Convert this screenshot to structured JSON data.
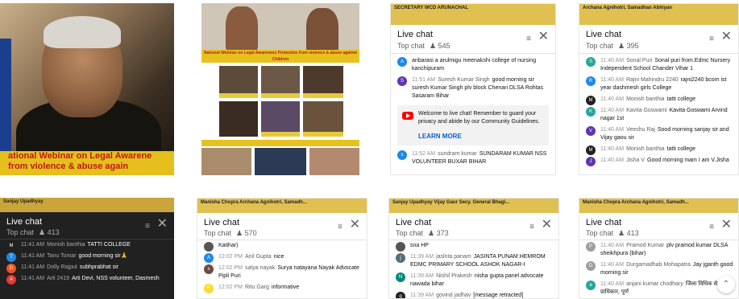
{
  "tiles": {
    "video1": {
      "banner_line1": "ational Webinar on Legal Awarene",
      "banner_line2": "from violence & abuse  again"
    },
    "video2": {
      "strip_text": "National Webinar on Legal Awareness Protection from violence & abuse against Children"
    },
    "chat1": {
      "header_text": "SECRETARY WCD ARUNACHAL",
      "title": "Live chat",
      "mode": "Top chat",
      "viewers": "545",
      "messages": [
        {
          "avatar": "A",
          "color": "#1e88e5",
          "time": "",
          "author": "",
          "text": "anbarasi a arulmigu meenakshi college of nursing kanchipuram"
        },
        {
          "avatar": "S",
          "color": "#5e35b1",
          "time": "11:51 AM",
          "author": "Suresh Kumar Singh",
          "text": "good morning sir suresh Kumar Singh plv block Chenari DLSA Rohtas Sasaram Bihar"
        }
      ],
      "notice": "Welcome to live chat! Remember to guard your privacy and abide by our Community Guidelines.",
      "learn_more": "LEARN MORE",
      "messages2": [
        {
          "avatar": "s",
          "color": "#1e88e5",
          "time": "11:52 AM",
          "author": "sundram kumar",
          "text": "SUNDARAM KUMAR NSS VOLUNTEER BUXAR BIHAR"
        }
      ]
    },
    "chat2": {
      "header_text": "Archana Agnihotri, Samadhan Abhiyan",
      "title": "Live chat",
      "mode": "Top chat",
      "viewers": "395",
      "messages": [
        {
          "avatar": "S",
          "color": "#26a69a",
          "time": "11:40 AM",
          "author": "Sonal Puri",
          "text": "Sonal puri from.Edmc Nursery Independent School Chander Vihar 1"
        },
        {
          "avatar": "R",
          "color": "#1e88e5",
          "time": "11:40 AM",
          "author": "Rajni Mahindru 2240",
          "text": "rajni2240 bcom ist year dashmesh girls College"
        },
        {
          "avatar": "M",
          "color": "#212121",
          "time": "11:40 AM",
          "author": "Monish banthia",
          "text": "tatti college"
        },
        {
          "avatar": "K",
          "color": "#26a69a",
          "time": "11:40 AM",
          "author": "Kavita Goswami",
          "text": "Kavita Goswami Arvind nagar 1st"
        },
        {
          "avatar": "V",
          "color": "#5e35b1",
          "time": "11:40 AM",
          "author": "Veeshu Raj",
          "text": "Sood morning sanjay sir and Vijay gaou sir"
        },
        {
          "avatar": "M",
          "color": "#212121",
          "time": "11:40 AM",
          "author": "Monish banthia",
          "text": "tatti college"
        },
        {
          "avatar": "J",
          "color": "#5e35b1",
          "time": "11:40 AM",
          "author": "Jisha V",
          "text": "Good morning mam I am V.Jisha"
        }
      ]
    },
    "chat3": {
      "header_text": "Sanjay Upadhyay",
      "title": "Live chat",
      "mode": "Top chat",
      "viewers": "413",
      "messages": [
        {
          "avatar": "M",
          "color": "#212121",
          "time": "11:41 AM",
          "author": "Monish banthia",
          "text": "TATTI COLLEGE"
        },
        {
          "avatar": "T",
          "color": "#1e88e5",
          "time": "11:41 AM",
          "author": "Tanu Tomar",
          "text": "good morning sir🙏"
        },
        {
          "avatar": "D",
          "color": "#f4511e",
          "time": "11:41 AM",
          "author": "Dolly Rajput",
          "text": "subhprabhat sir"
        },
        {
          "avatar": "A",
          "color": "#e53935",
          "time": "11:41 AM",
          "author": "Arti 2419",
          "text": "Arti Devi, NSS volunteer, Dasmesh"
        }
      ]
    },
    "chat4": {
      "header_text": "Manisha Chopra    Archana Agnihotri, Samadh...",
      "title": "Live chat",
      "mode": "Top chat",
      "viewers": "570",
      "messages": [
        {
          "avatar": "",
          "color": "#555555",
          "time": "",
          "author": "",
          "text": "Katihar)"
        },
        {
          "avatar": "A",
          "color": "#1e88e5",
          "time": "12:02 PM",
          "author": "Anil Gupta",
          "text": "nice"
        },
        {
          "avatar": "s",
          "color": "#6d4c41",
          "time": "12:02 PM",
          "author": "satya nayak",
          "text": "Surya natayana Nayak Advocate Pipli Puri"
        },
        {
          "avatar": "R",
          "color": "#fdd835",
          "time": "12:02 PM",
          "author": "Ritu Garg",
          "text": "informative"
        }
      ]
    },
    "chat5": {
      "header_text": "Sanjay Upadhyay       Vijay Gaur Secy. General Bhagi...",
      "title": "Live chat",
      "mode": "Top chat",
      "viewers": "373",
      "messages": [
        {
          "avatar": "",
          "color": "#555555",
          "time": "",
          "author": "",
          "text": "sna HP"
        },
        {
          "avatar": "j",
          "color": "#546e7a",
          "time": "11:39 AM",
          "author": "jaslnta panam",
          "text": "JASINTA PUNAM HEMROM EDMC PRIMARY SCHOOL ASHOK NAGAR-I"
        },
        {
          "avatar": "N",
          "color": "#00897b",
          "time": "11:39 AM",
          "author": "Nishil Prakesh",
          "text": "nisha gupta panel advocate nawada bihar"
        },
        {
          "avatar": "g",
          "color": "#212121",
          "time": "11:39 AM",
          "author": "govind jadhav",
          "text": "[message retracted]"
        }
      ]
    },
    "chat6": {
      "header_text": "Manisha Chopra                 Archana Agnihotri, Samadh...",
      "title": "Live chat",
      "mode": "Top chat",
      "viewers": "413",
      "messages": [
        {
          "avatar": "P",
          "color": "#9e9e9e",
          "time": "11:40 AM",
          "author": "Pramod Kumar",
          "text": "plv pramod kumar DLSA sheikhpura (bihar)"
        },
        {
          "avatar": "D",
          "color": "#9e9e9e",
          "time": "11:40 AM",
          "author": "Durgamadhab Mohapatra",
          "text": "Jay jganth good morning sir"
        },
        {
          "avatar": "a",
          "color": "#26a69a",
          "time": "11:40 AM",
          "author": "anjani kumar chodhary",
          "text": "जिला विधिक सेवा प्राधिकार, पूर्ण"
        }
      ]
    }
  },
  "icons": {
    "filter": "sliders-icon",
    "close": "close-icon",
    "viewers": "person-icon",
    "scroll": "chevron-up-icon"
  }
}
